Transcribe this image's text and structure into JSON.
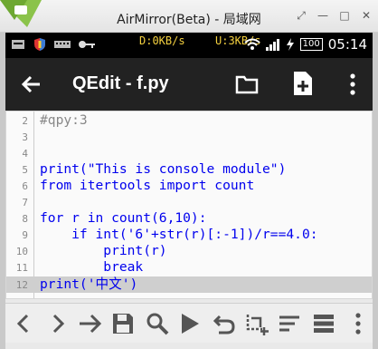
{
  "window": {
    "title": "AirMirror(Beta) - 局域网",
    "controls": [
      "pin-icon",
      "minimize-icon",
      "maximize-icon",
      "close-icon"
    ]
  },
  "statusbar": {
    "download_speed": "D:0KB/s",
    "upload_speed": "U:3KB/s",
    "battery": "100",
    "time": "05:14"
  },
  "appbar": {
    "title": "QEdit - f.py"
  },
  "editor": {
    "lines": [
      {
        "num": "2",
        "text": "#qpy:3"
      },
      {
        "num": "3",
        "text": ""
      },
      {
        "num": "4",
        "text": ""
      },
      {
        "num": "5",
        "text": "print(\"This is console module\")"
      },
      {
        "num": "6",
        "text": "from itertools import count"
      },
      {
        "num": "7",
        "text": ""
      },
      {
        "num": "8",
        "text": "for r in count(6,10):"
      },
      {
        "num": "9",
        "text": "    if int('6'+str(r)[:-1])/r==4.0:"
      },
      {
        "num": "10",
        "text": "        print(r)"
      },
      {
        "num": "11",
        "text": "        break"
      },
      {
        "num": "12",
        "text": "print('中文')"
      }
    ],
    "highlighted_line": "12"
  },
  "bottombar": {
    "icons": [
      "undo-arrow-left-icon",
      "redo-arrow-right-icon",
      "goto-line-icon",
      "save-icon",
      "search-icon",
      "run-icon",
      "undo-icon",
      "snippet-icon",
      "format-icon",
      "settings-list-icon"
    ]
  },
  "colors": {
    "appbar_bg": "#222222",
    "keyword": "#0000ee",
    "highlight": "#cfcfcf"
  }
}
